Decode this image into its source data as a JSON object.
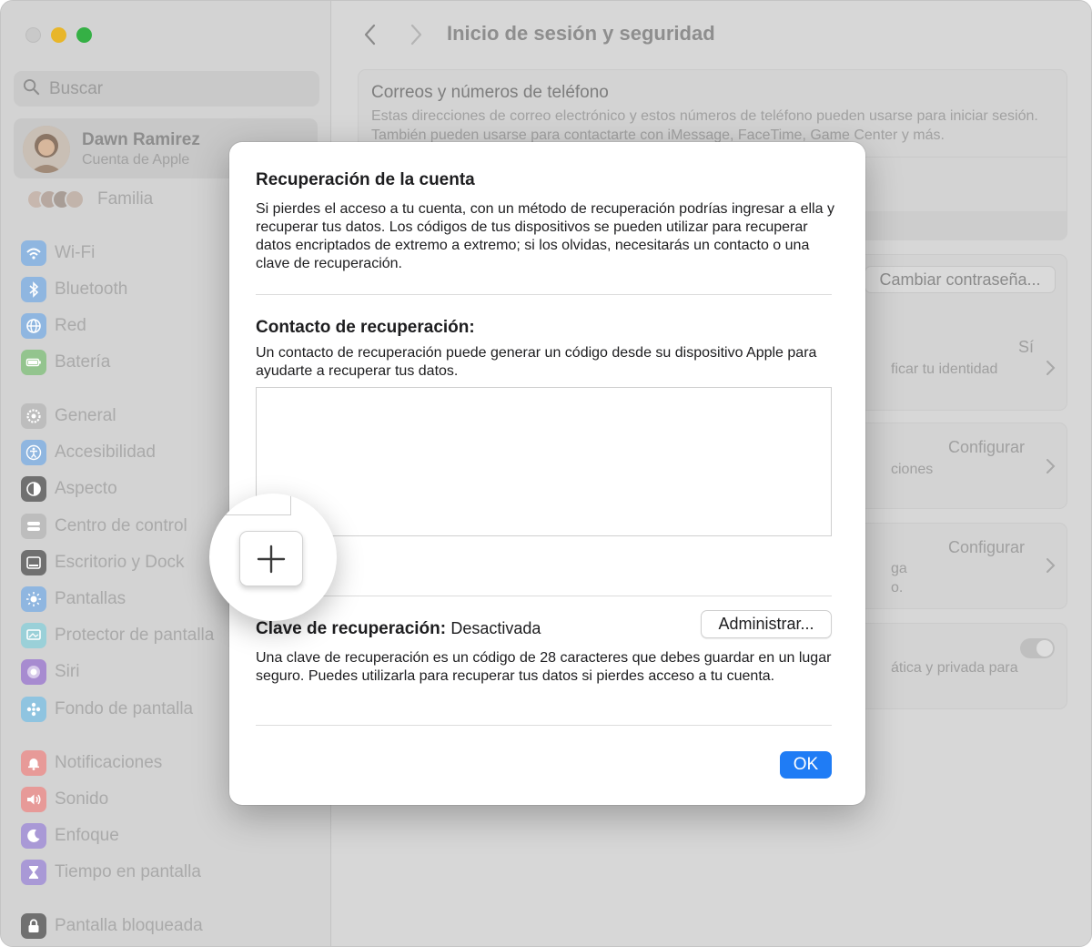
{
  "sidebar": {
    "search_placeholder": "Buscar",
    "account": {
      "name": "Dawn Ramirez",
      "subtitle": "Cuenta de Apple"
    },
    "family_label": "Familia",
    "items": [
      {
        "label": "Wi-Fi",
        "icon": "wifi-icon",
        "color": "#8fb6e0"
      },
      {
        "label": "Bluetooth",
        "icon": "bluetooth-icon",
        "color": "#8fb6e0"
      },
      {
        "label": "Red",
        "icon": "globe-icon",
        "color": "#8fb6e0"
      },
      {
        "label": "Batería",
        "icon": "battery-icon",
        "color": "#93c48e"
      },
      {
        "label": "General",
        "icon": "gear-icon",
        "color": "#bdbdbd"
      },
      {
        "label": "Accesibilidad",
        "icon": "accessibility-icon",
        "color": "#8fb6e0"
      },
      {
        "label": "Aspecto",
        "icon": "appearance-icon",
        "color": "#707070"
      },
      {
        "label": "Centro de control",
        "icon": "control-center-icon",
        "color": "#bdbdbd"
      },
      {
        "label": "Escritorio y Dock",
        "icon": "dock-icon",
        "color": "#707070"
      },
      {
        "label": "Pantallas",
        "icon": "sun-icon",
        "color": "#8fb6e0"
      },
      {
        "label": "Protector de pantalla",
        "icon": "screensaver-icon",
        "color": "#9ad0d8"
      },
      {
        "label": "Siri",
        "icon": "siri-icon",
        "color": "#a78bd0"
      },
      {
        "label": "Fondo de pantalla",
        "icon": "wallpaper-icon",
        "color": "#8fc4e0"
      },
      {
        "label": "Notificaciones",
        "icon": "bell-icon",
        "color": "#e79a98"
      },
      {
        "label": "Sonido",
        "icon": "speaker-icon",
        "color": "#e79a98"
      },
      {
        "label": "Enfoque",
        "icon": "moon-icon",
        "color": "#a999d6"
      },
      {
        "label": "Tiempo en pantalla",
        "icon": "hourglass-icon",
        "color": "#a999d6"
      },
      {
        "label": "Pantalla bloqueada",
        "icon": "lock-icon",
        "color": "#707070"
      }
    ]
  },
  "main": {
    "title": "Inicio de sesión y seguridad",
    "emails_panel": {
      "title": "Correos y números de teléfono",
      "description": "Estas direcciones de correo electrónico y estos números de teléfono pueden usarse para iniciar sesión. También pueden usarse para contactarte con iMessage, FaceTime, Game Center y más."
    },
    "change_password_label": "Cambiar contraseña...",
    "two_factor": {
      "value": "Sí",
      "partial_text": "ficar tu identidad"
    },
    "row3": {
      "value": "Configurar",
      "partial_text": "ciones"
    },
    "row4": {
      "value": "Configurar",
      "partial_line1": "ga",
      "partial_line2": "o."
    },
    "row5": {
      "partial_text": "ática y privada para"
    }
  },
  "dialog": {
    "title": "Recuperación de la cuenta",
    "intro": "Si pierdes el acceso a tu cuenta, con un método de recuperación podrías ingresar a ella y recuperar tus datos. Los códigos de tus dispositivos se pueden utilizar para recuperar datos encriptados de extremo a extremo; si los olvidas, necesitarás un contacto o una clave de recuperación.",
    "contact_heading": "Contacto de recuperación:",
    "contact_desc": "Un contacto de recuperación puede generar un código desde su dispositivo Apple para ayudarte a recuperar tus datos.",
    "key_heading": "Clave de recuperación:",
    "key_status": "Desactivada",
    "manage_label": "Administrar...",
    "key_desc": "Una clave de recuperación es un código de 28 caracteres que debes guardar en un lugar seguro. Puedes utilizarla para recuperar tus datos si pierdes acceso a tu cuenta.",
    "ok_label": "OK"
  },
  "colors": {
    "accent": "#1f7cf5"
  }
}
